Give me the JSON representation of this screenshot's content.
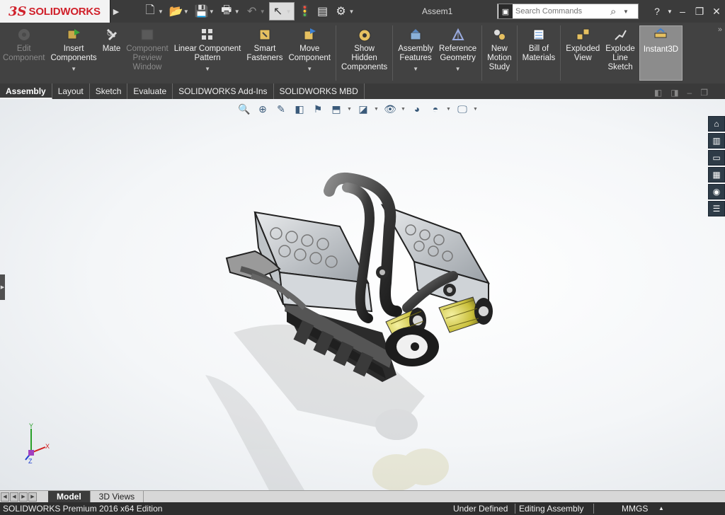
{
  "app": {
    "brand": "SOLIDWORKS",
    "document_title": "Assem1"
  },
  "quick_access": [
    {
      "icon": "new-document-icon",
      "glyph": "🗋",
      "has_dropdown": true
    },
    {
      "icon": "open-icon",
      "glyph": "📂",
      "has_dropdown": true
    },
    {
      "icon": "save-icon",
      "glyph": "💾",
      "has_dropdown": true
    },
    {
      "icon": "print-icon",
      "glyph": "🖶",
      "has_dropdown": true
    },
    {
      "icon": "undo-icon",
      "glyph": "↶",
      "has_dropdown": true,
      "disabled": true
    },
    {
      "icon": "select-icon",
      "glyph": "↖",
      "has_dropdown": true,
      "active": true
    },
    {
      "icon": "rebuild-icon",
      "glyph": "🚦",
      "has_dropdown": false
    },
    {
      "icon": "file-properties-icon",
      "glyph": "▤",
      "has_dropdown": false
    },
    {
      "icon": "options-icon",
      "glyph": "⚙",
      "has_dropdown": true
    }
  ],
  "search": {
    "placeholder": "Search Commands"
  },
  "help_icon": "?",
  "commands": [
    {
      "label": "Edit\nComponent",
      "icon": "edit-component-icon",
      "disabled": true,
      "dropdown": false
    },
    {
      "label": "Insert\nComponents",
      "icon": "insert-components-icon",
      "disabled": false,
      "dropdown": true
    },
    {
      "label": "Mate",
      "icon": "mate-icon",
      "disabled": false,
      "dropdown": false
    },
    {
      "label": "Component\nPreview\nWindow",
      "icon": "component-preview-icon",
      "disabled": true,
      "dropdown": false
    },
    {
      "label": "Linear Component\nPattern",
      "icon": "linear-pattern-icon",
      "disabled": false,
      "dropdown": true
    },
    {
      "label": "Smart\nFasteners",
      "icon": "smart-fasteners-icon",
      "disabled": false,
      "dropdown": false
    },
    {
      "label": "Move\nComponent",
      "icon": "move-component-icon",
      "disabled": false,
      "dropdown": true
    },
    {
      "label": "Show\nHidden\nComponents",
      "icon": "show-hidden-icon",
      "disabled": false,
      "dropdown": false,
      "sep_before": true
    },
    {
      "label": "Assembly\nFeatures",
      "icon": "assembly-features-icon",
      "disabled": false,
      "dropdown": true,
      "sep_before": true
    },
    {
      "label": "Reference\nGeometry",
      "icon": "reference-geometry-icon",
      "disabled": false,
      "dropdown": true
    },
    {
      "label": "New\nMotion\nStudy",
      "icon": "motion-study-icon",
      "disabled": false,
      "dropdown": false,
      "sep_before": true
    },
    {
      "label": "Bill of\nMaterials",
      "icon": "bill-of-materials-icon",
      "disabled": false,
      "dropdown": false,
      "sep_before": true
    },
    {
      "label": "Exploded\nView",
      "icon": "exploded-view-icon",
      "disabled": false,
      "dropdown": false,
      "sep_before": true
    },
    {
      "label": "Explode\nLine\nSketch",
      "icon": "explode-line-sketch-icon",
      "disabled": false,
      "dropdown": false
    },
    {
      "label": "Instant3D",
      "icon": "instant3d-icon",
      "disabled": false,
      "dropdown": false,
      "active": true
    }
  ],
  "tabs": [
    "Assembly",
    "Layout",
    "Sketch",
    "Evaluate",
    "SOLIDWORKS Add-Ins",
    "SOLIDWORKS MBD"
  ],
  "active_tab": "Assembly",
  "heads_up_view": [
    {
      "icon": "zoom-to-fit-icon",
      "glyph": "🔍",
      "dropdown": false
    },
    {
      "icon": "zoom-to-area-icon",
      "glyph": "⊕",
      "dropdown": false
    },
    {
      "icon": "previous-view-icon",
      "glyph": "✎",
      "dropdown": false
    },
    {
      "icon": "section-view-icon",
      "glyph": "◧",
      "dropdown": false
    },
    {
      "icon": "dynamic-annotation-icon",
      "glyph": "⚑",
      "dropdown": false
    },
    {
      "icon": "view-orientation-icon",
      "glyph": "⬒",
      "dropdown": true
    },
    {
      "icon": "display-style-icon",
      "glyph": "◪",
      "dropdown": true
    },
    {
      "icon": "hide-show-items-icon",
      "glyph": "👁",
      "dropdown": true
    },
    {
      "icon": "edit-appearance-icon",
      "glyph": "◕",
      "dropdown": false
    },
    {
      "icon": "apply-scene-icon",
      "glyph": "◓",
      "dropdown": true
    },
    {
      "icon": "view-settings-icon",
      "glyph": "🖵",
      "dropdown": true
    }
  ],
  "task_pane": [
    {
      "icon": "solidworks-resources-icon",
      "glyph": "⌂"
    },
    {
      "icon": "design-library-icon",
      "glyph": "▥"
    },
    {
      "icon": "file-explorer-icon",
      "glyph": "▭"
    },
    {
      "icon": "view-palette-icon",
      "glyph": "▦"
    },
    {
      "icon": "appearances-icon",
      "glyph": "◉"
    },
    {
      "icon": "custom-properties-icon",
      "glyph": "☰"
    }
  ],
  "triad": {
    "x": "X",
    "y": "Y",
    "z": "Z"
  },
  "bottom_tabs": [
    "Model",
    "3D Views"
  ],
  "active_bottom_tab": "Model",
  "status": {
    "edition": "SOLIDWORKS Premium 2016 x64 Edition",
    "state": "Under Defined",
    "mode": "Editing Assembly",
    "units": "MMGS"
  },
  "colors": {
    "brand_red": "#d0202a",
    "title_bar": "#3b3b3b",
    "command_bar": "#424242",
    "status_bar": "#2e2e2e"
  }
}
